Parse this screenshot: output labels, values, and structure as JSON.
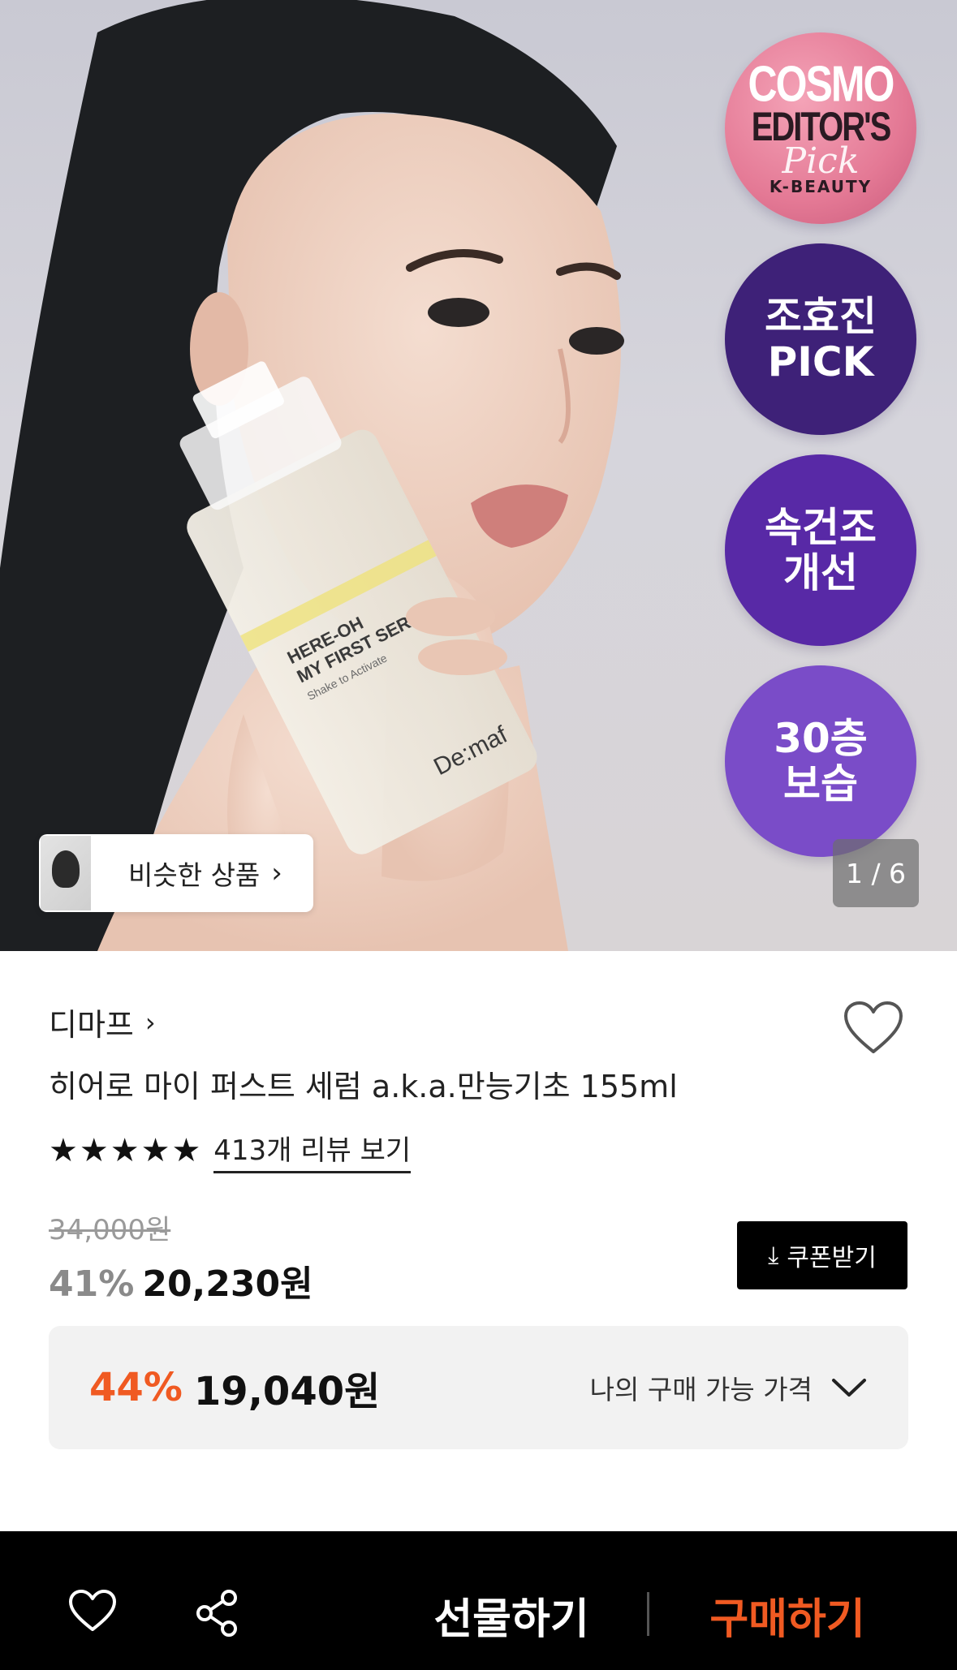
{
  "hero": {
    "badges": {
      "cosmo": {
        "line1": "COSMO",
        "line2": "EDITOR'S",
        "line3": "Pick",
        "line4": "K-BEAUTY"
      },
      "badge1": "조효진\nPICK",
      "badge2": "속건조\n개선",
      "badge3": "30층\n보습"
    },
    "bottle": {
      "line1": "HERE-OH",
      "line2": "MY FIRST SERUM",
      "line3": "Shake to Activate",
      "brand": "De:maf"
    },
    "similar_label": "비슷한 상품",
    "counter": "1 / 6"
  },
  "product": {
    "brand": "디마프",
    "title": "히어로 마이 퍼스트 세럼 a.k.a.만능기초 155ml",
    "rating": 5,
    "review_link": "413개 리뷰 보기",
    "original_price": "34,000원",
    "discount": "41%",
    "price": "20,230원",
    "coupon_label": "쿠폰받기"
  },
  "my_price": {
    "discount": "44%",
    "price": "19,040원",
    "label": "나의 구매 가능 가격"
  },
  "bottom_bar": {
    "gift_label": "선물하기",
    "buy_label": "구매하기"
  },
  "colors": {
    "accent": "#f05a22",
    "badge1": "#3e2178",
    "badge2": "#5829a6",
    "badge3": "#7a4cc8"
  }
}
